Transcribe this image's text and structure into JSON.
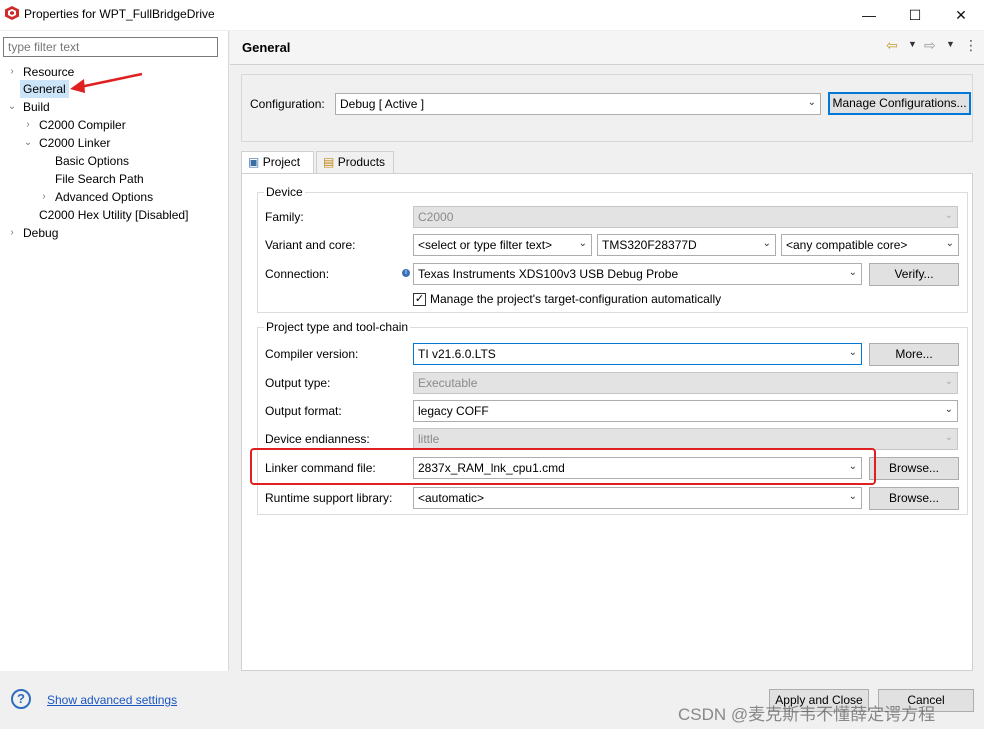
{
  "window": {
    "title": "Properties for WPT_FullBridgeDrive",
    "minimize": "—",
    "maximize": "☐",
    "close": "✕"
  },
  "left": {
    "filter_placeholder": "type filter text",
    "tree": [
      {
        "label": "Resource",
        "arrow": "›"
      },
      {
        "label": "General"
      },
      {
        "label": "Build",
        "arrow": "⌄"
      },
      {
        "label": "C2000 Compiler",
        "arrow": "›"
      },
      {
        "label": "C2000 Linker",
        "arrow": "⌄"
      },
      {
        "label": "Basic Options"
      },
      {
        "label": "File Search Path"
      },
      {
        "label": "Advanced Options",
        "arrow": "›"
      },
      {
        "label": "C2000 Hex Utility  [Disabled]"
      },
      {
        "label": "Debug",
        "arrow": "›"
      }
    ]
  },
  "header": {
    "title": "General"
  },
  "configuration": {
    "label": "Configuration:",
    "value": "Debug  [ Active ]",
    "manage_button": "Manage Configurations..."
  },
  "tabs": [
    {
      "label": "Project"
    },
    {
      "label": "Products"
    }
  ],
  "device": {
    "group_title": "Device",
    "family_label": "Family:",
    "family_value": "C2000",
    "variant_label": "Variant and core:",
    "variant_filter": "<select or type filter text>",
    "variant_value": "TMS320F28377D",
    "core_value": "<any compatible core>",
    "connection_label": "Connection:",
    "connection_value": "Texas Instruments XDS100v3 USB Debug Probe",
    "verify_button": "Verify...",
    "manage_checkbox_label": "Manage the project's target-configuration automatically"
  },
  "toolchain": {
    "group_title": "Project type and tool-chain",
    "compiler_label": "Compiler version:",
    "compiler_value": "TI v21.6.0.LTS",
    "more_button": "More...",
    "output_type_label": "Output type:",
    "output_type_value": "Executable",
    "output_format_label": "Output format:",
    "output_format_value": "legacy COFF",
    "endianness_label": "Device endianness:",
    "endianness_value": "little",
    "linker_cmd_label": "Linker command file:",
    "linker_cmd_value": "2837x_RAM_lnk_cpu1.cmd",
    "browse_button": "Browse...",
    "runtime_label": "Runtime support library:",
    "runtime_value": "<automatic>",
    "browse_button2": "Browse..."
  },
  "footer": {
    "show_advanced": "Show advanced settings",
    "apply_close": "Apply and Close",
    "cancel": "Cancel",
    "watermark": "CSDN @麦克斯韦不懂薛定谔方程"
  },
  "colors": {
    "highlight": "#e02020",
    "arrow": "#e02020",
    "accent": "#0078d7"
  }
}
